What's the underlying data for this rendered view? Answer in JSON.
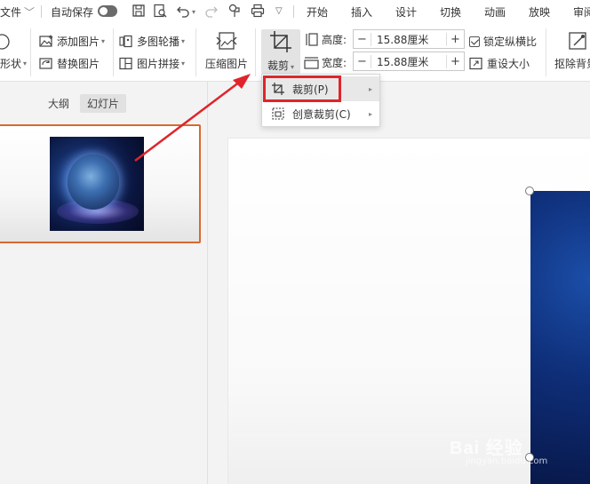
{
  "menubar": {
    "file": "文件",
    "autosave": "自动保存",
    "tabs": [
      "开始",
      "插入",
      "设计",
      "切换",
      "动画",
      "放映",
      "审阅"
    ]
  },
  "ribbon": {
    "shape_label": "形状",
    "add_picture": "添加图片",
    "replace_picture": "替换图片",
    "multi_carousel": "多图轮播",
    "picture_collage": "图片拼接",
    "compress_picture": "压缩图片",
    "crop": "裁剪",
    "height_label": "高度:",
    "height_value": "15.88厘米",
    "width_label": "宽度:",
    "width_value": "15.88厘米",
    "lock_ratio": "锁定纵横比",
    "reset_size": "重设大小",
    "remove_background": "抠除背景"
  },
  "dropdown": {
    "items": [
      {
        "label": "裁剪(P)"
      },
      {
        "label": "创意裁剪(C)"
      }
    ]
  },
  "left_pane": {
    "tab_outline": "大纲",
    "tab_slides": "幻灯片"
  },
  "watermark": {
    "main": "Bai 经验",
    "sub": "jingyan.baidu.com"
  },
  "colors": {
    "highlight_red": "#e0242b",
    "selected_thumb_border": "#d9692d"
  }
}
